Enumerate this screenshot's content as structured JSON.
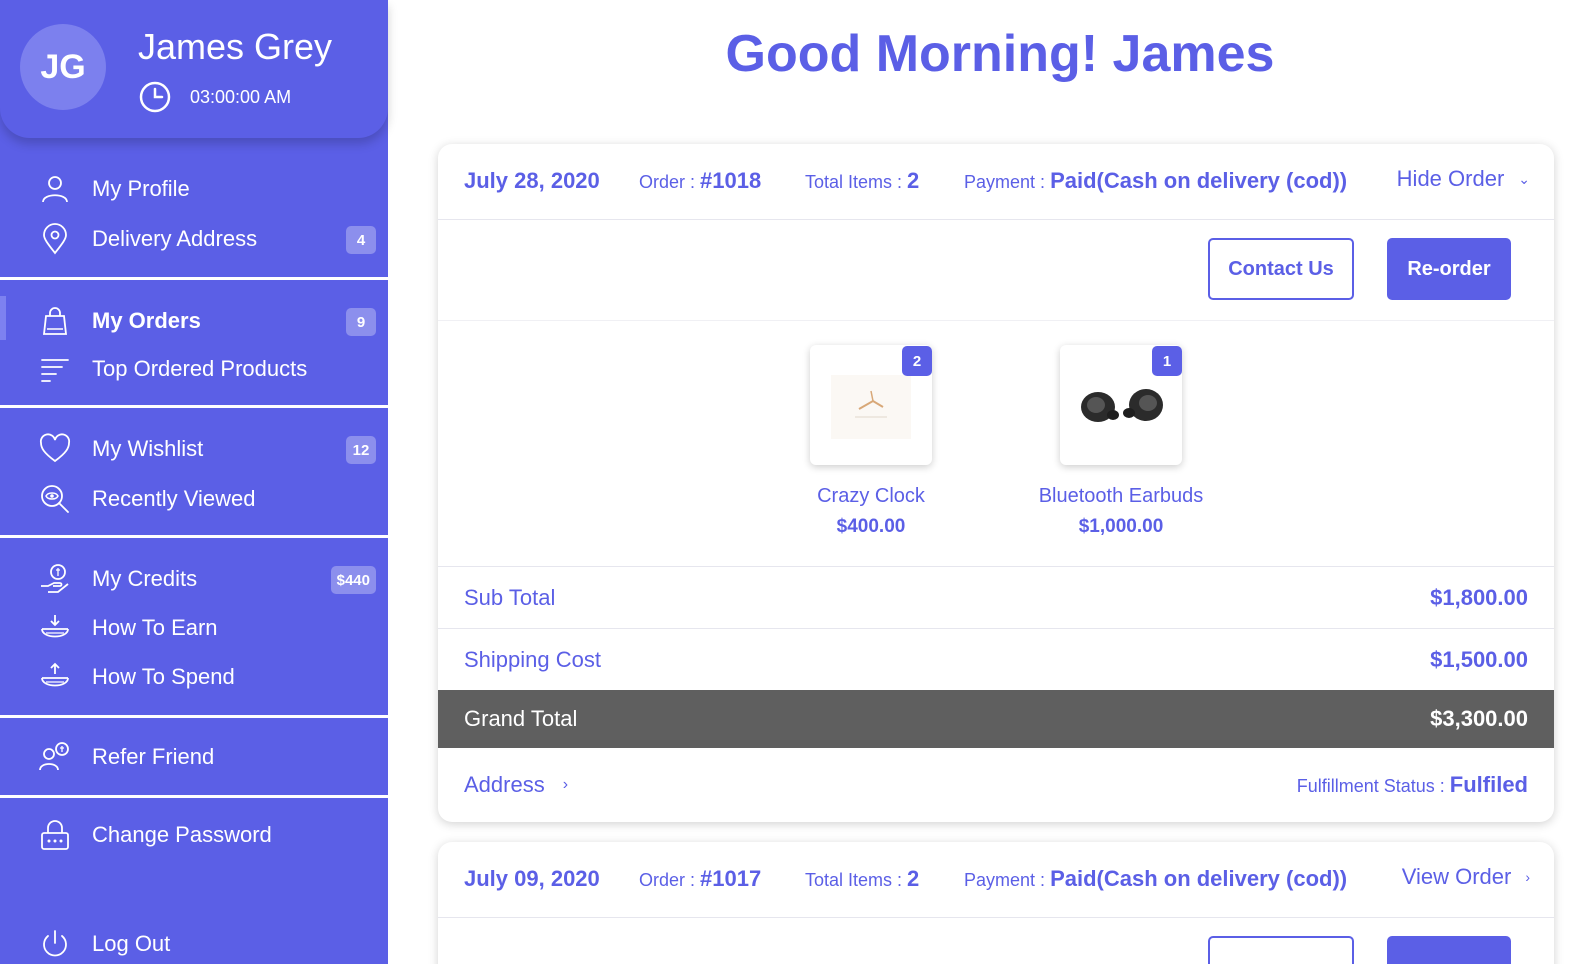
{
  "user": {
    "initials": "JG",
    "name": "James Grey",
    "time": "03:00:00 AM"
  },
  "greeting": "Good Morning! James",
  "sidebar": {
    "items": [
      {
        "label": "My Profile"
      },
      {
        "label": "Delivery Address",
        "badge": "4"
      },
      {
        "label": "My Orders",
        "badge": "9"
      },
      {
        "label": "Top Ordered Products"
      },
      {
        "label": "My Wishlist",
        "badge": "12"
      },
      {
        "label": "Recently Viewed"
      },
      {
        "label": "My Credits",
        "badge": "$440"
      },
      {
        "label": "How To Earn"
      },
      {
        "label": "How To Spend"
      },
      {
        "label": "Refer Friend"
      },
      {
        "label": "Change Password"
      },
      {
        "label": "Log Out"
      }
    ]
  },
  "orders": [
    {
      "date": "July 28, 2020",
      "order_label": "Order :",
      "order_no": "#1018",
      "items_label": "Total Items :",
      "items": "2",
      "payment_label": "Payment :",
      "payment": "Paid(Cash on delivery (cod))",
      "toggle": "Hide Order",
      "contact": "Contact Us",
      "reorder": "Re-order",
      "products": [
        {
          "name": "Crazy Clock",
          "price": "$400.00",
          "qty": "2"
        },
        {
          "name": "Bluetooth Earbuds",
          "price": "$1,000.00",
          "qty": "1"
        }
      ],
      "subtotal_label": "Sub Total",
      "subtotal": "$1,800.00",
      "shipping_label": "Shipping Cost",
      "shipping": "$1,500.00",
      "grand_label": "Grand Total",
      "grand": "$3,300.00",
      "address_label": "Address",
      "fulfillment_label": "Fulfillment Status :",
      "fulfillment": "Fulfiled"
    },
    {
      "date": "July 09, 2020",
      "order_label": "Order :",
      "order_no": "#1017",
      "items_label": "Total Items :",
      "items": "2",
      "payment_label": "Payment :",
      "payment": "Paid(Cash on delivery (cod))",
      "toggle": "View Order"
    }
  ],
  "colors": {
    "accent": "#5b5fe6",
    "grand_bg": "#5f5f5f"
  },
  "icons": [
    "clock-icon",
    "user-icon",
    "location-pin-icon",
    "shopping-bag-icon",
    "list-icon",
    "heart-icon",
    "search-eye-icon",
    "hand-coin-icon",
    "earn-icon",
    "spend-icon",
    "refer-icon",
    "lock-icon",
    "power-icon"
  ]
}
